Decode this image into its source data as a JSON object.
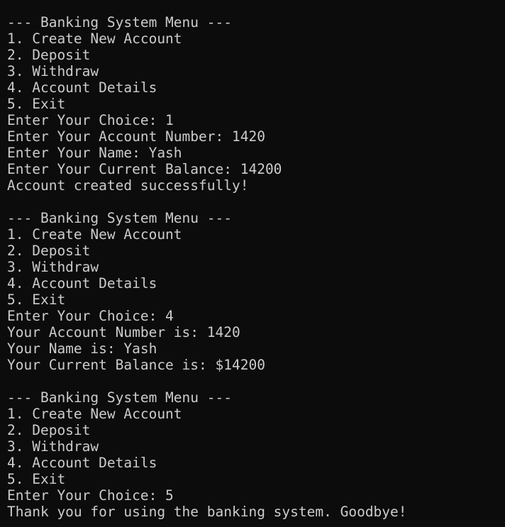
{
  "terminal": {
    "lines": [
      "--- Banking System Menu ---",
      "1. Create New Account",
      "2. Deposit",
      "3. Withdraw",
      "4. Account Details",
      "5. Exit",
      "Enter Your Choice: 1",
      "Enter Your Account Number: 1420",
      "Enter Your Name: Yash",
      "Enter Your Current Balance: 14200",
      "Account created successfully!",
      "",
      "--- Banking System Menu ---",
      "1. Create New Account",
      "2. Deposit",
      "3. Withdraw",
      "4. Account Details",
      "5. Exit",
      "Enter Your Choice: 4",
      "Your Account Number is: 1420",
      "Your Name is: Yash",
      "Your Current Balance is: $14200",
      "",
      "--- Banking System Menu ---",
      "1. Create New Account",
      "2. Deposit",
      "3. Withdraw",
      "4. Account Details",
      "5. Exit",
      "Enter Your Choice: 5",
      "Thank you for using the banking system. Goodbye!"
    ]
  },
  "colors": {
    "background": "#0c0c0c",
    "text": "#cccccc"
  }
}
